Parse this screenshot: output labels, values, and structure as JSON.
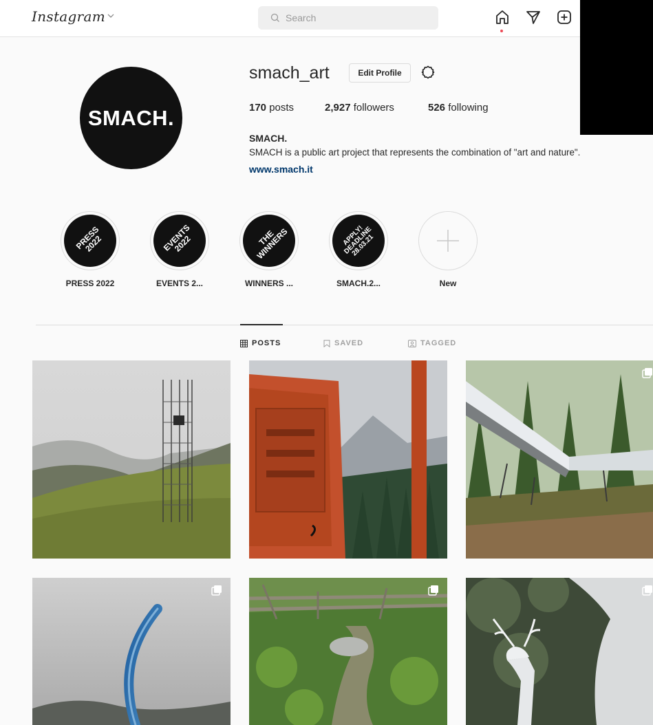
{
  "app": {
    "logo": "Instagram"
  },
  "search": {
    "placeholder": "Search"
  },
  "nav": {
    "icons": [
      "home-icon",
      "direct-icon",
      "new-post-icon"
    ]
  },
  "profile": {
    "username": "smach_art",
    "edit_label": "Edit Profile",
    "avatar_text": "SMACH.",
    "stats": [
      {
        "value": "170",
        "label": "posts"
      },
      {
        "value": "2,927",
        "label": "followers"
      },
      {
        "value": "526",
        "label": "following"
      }
    ],
    "full_name": "SMACH.",
    "bio": "SMACH is a public art project that represents the combination of \"art and nature\".",
    "website": "www.smach.it"
  },
  "highlights": [
    {
      "cover": "PRESS\n2022",
      "label": "PRESS 2022"
    },
    {
      "cover": "EVENTS\n2022",
      "label": "EVENTS 2..."
    },
    {
      "cover": "THE\nWINNERS",
      "label": "WINNERS ..."
    },
    {
      "cover": "APPLY!\nDEADLINE\n28.03.21",
      "label": "SMACH.2..."
    },
    {
      "cover": "",
      "label": "New"
    }
  ],
  "tabs": [
    {
      "label": "POSTS",
      "active": true
    },
    {
      "label": "SAVED",
      "active": false
    },
    {
      "label": "TAGGED",
      "active": false
    }
  ],
  "colors": {
    "link": "#00376b",
    "notification_dot": "#ed4956",
    "text": "#262626",
    "muted": "#8e8e8e"
  }
}
